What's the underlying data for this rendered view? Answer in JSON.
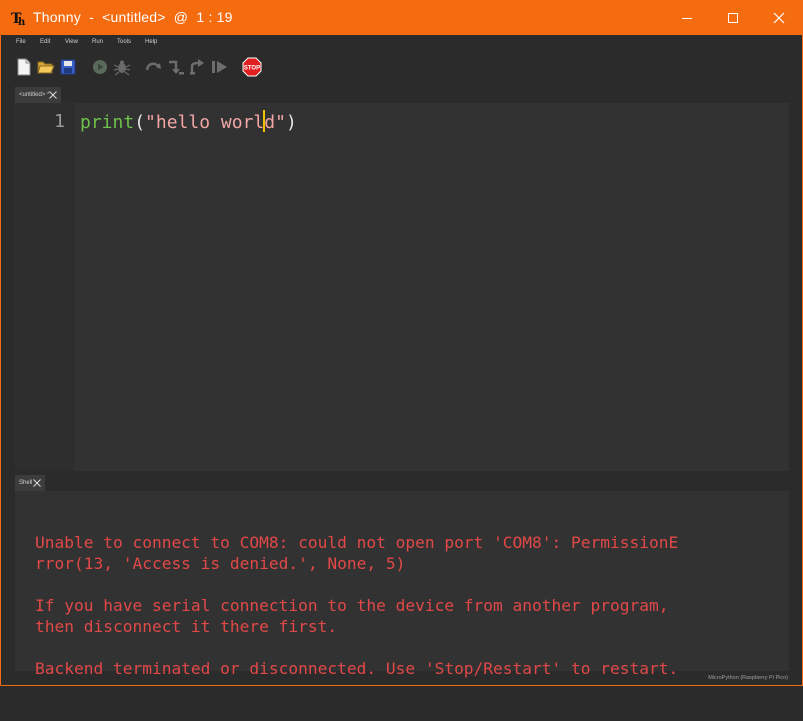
{
  "window": {
    "title": "Thonny  -  <untitled>  @  1 : 19",
    "app_icon": "thonny-logo-icon",
    "controls": [
      "minimize-icon",
      "maximize-icon",
      "close-icon"
    ]
  },
  "menu": {
    "items": [
      "File",
      "Edit",
      "View",
      "Run",
      "Tools",
      "Help"
    ]
  },
  "toolbar": {
    "buttons": [
      {
        "name": "new-file",
        "icon": "new-file-icon"
      },
      {
        "name": "open-file",
        "icon": "folder-open-icon"
      },
      {
        "name": "save-file",
        "icon": "save-icon"
      },
      {
        "name": "run",
        "icon": "run-icon"
      },
      {
        "name": "debug",
        "icon": "debug-icon"
      },
      {
        "name": "step-over",
        "icon": "step-over-icon"
      },
      {
        "name": "step-into",
        "icon": "step-into-icon"
      },
      {
        "name": "step-out",
        "icon": "step-out-icon"
      },
      {
        "name": "resume",
        "icon": "resume-icon"
      },
      {
        "name": "stop",
        "icon": "stop-icon",
        "label": "STOP"
      }
    ]
  },
  "editor": {
    "tab_label": "<untitled> *",
    "line_number": "1",
    "code": {
      "fn": "print",
      "open": "(",
      "string_before_caret": "\"hello worl",
      "string_after_caret": "d\"",
      "close": ")"
    }
  },
  "shell": {
    "tab_label": "Shell",
    "lines": [
      "Unable to connect to COM8: could not open port 'COM8': PermissionE",
      "rror(13, 'Access is denied.', None, 5)",
      "",
      "If you have serial connection to the device from another program,",
      "then disconnect it there first.",
      "",
      "Backend terminated or disconnected. Use 'Stop/Restart' to restart."
    ],
    "text_color": "#e24848"
  },
  "statusbar": {
    "interpreter": "MicroPython (Raspberry Pi Pico)"
  },
  "colors": {
    "titlebar": "#f46b10",
    "background": "#2b2b2b",
    "editor_bg": "#323232",
    "keyword": "#6ec04a",
    "string": "#f2a6a6",
    "caret": "#f2c200"
  }
}
